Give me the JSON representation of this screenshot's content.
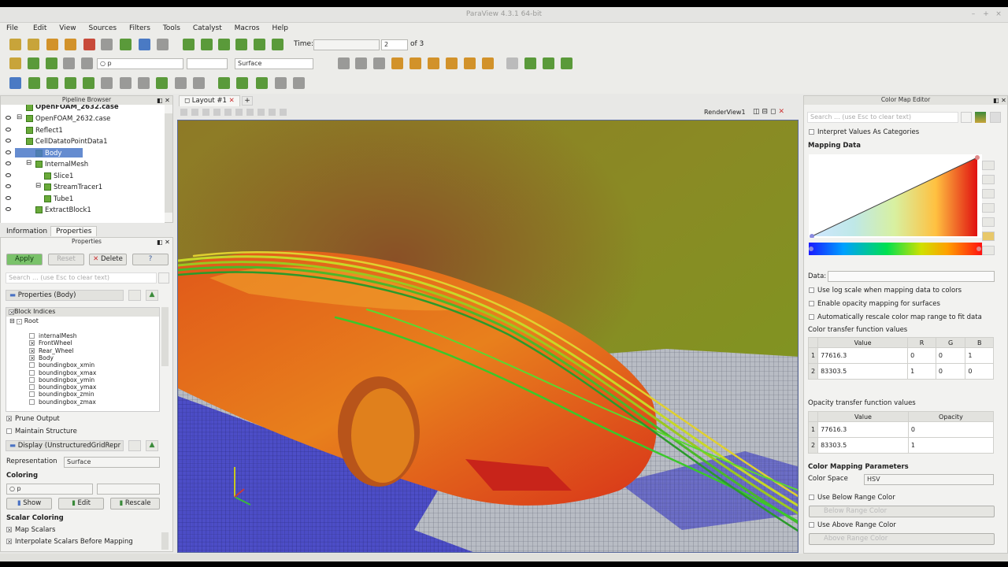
{
  "window": {
    "title": "ParaView 4.3.1 64-bit"
  },
  "menu": [
    "File",
    "Edit",
    "View",
    "Sources",
    "Filters",
    "Tools",
    "Catalyst",
    "Macros",
    "Help"
  ],
  "time": {
    "label": "Time:",
    "value": "",
    "index": "2",
    "of": "of 3"
  },
  "toolbar2": {
    "variable": "○ p",
    "representation": "Surface"
  },
  "pipeline": {
    "title": "Pipeline Browser",
    "items": [
      {
        "label": "OpenFOAM_2632.case",
        "depth": 1
      },
      {
        "label": "OpenFOAM_2632.case",
        "depth": 1
      },
      {
        "label": "Reflect1",
        "depth": 1
      },
      {
        "label": "CellDatatoPointData1",
        "depth": 1
      },
      {
        "label": "Body",
        "depth": 2,
        "selected": true
      },
      {
        "label": "InternalMesh",
        "depth": 2
      },
      {
        "label": "Slice1",
        "depth": 3
      },
      {
        "label": "StreamTracer1",
        "depth": 3
      },
      {
        "label": "Tube1",
        "depth": 3
      },
      {
        "label": "ExtractBlock1",
        "depth": 2
      }
    ]
  },
  "tabs": {
    "information": "Information",
    "properties": "Properties"
  },
  "properties": {
    "title": "Properties",
    "apply": "Apply",
    "reset": "Reset",
    "delete": "Delete",
    "help": "?",
    "search_placeholder": "Search ... (use Esc to clear text)",
    "section_body": "Properties (Body)",
    "block_indices": "Block Indices",
    "root": "Root",
    "blocks": [
      {
        "label": "internalMesh",
        "checked": false
      },
      {
        "label": "FrontWheel",
        "checked": true
      },
      {
        "label": "Rear_Wheel",
        "checked": true
      },
      {
        "label": "Body",
        "checked": true
      },
      {
        "label": "boundingbox_xmin",
        "checked": false
      },
      {
        "label": "boundingbox_xmax",
        "checked": false
      },
      {
        "label": "boundingbox_ymin",
        "checked": false
      },
      {
        "label": "boundingbox_ymax",
        "checked": false
      },
      {
        "label": "boundingbox_zmin",
        "checked": false
      },
      {
        "label": "boundingbox_zmax",
        "checked": false
      }
    ],
    "prune_output": "Prune Output",
    "maintain_structure": "Maintain Structure",
    "section_display": "Display (UnstructuredGridRepr",
    "representation_label": "Representation",
    "representation_value": "Surface",
    "coloring": "Coloring",
    "coloring_value": "○ p",
    "show": "Show",
    "edit": "Edit",
    "rescale": "Rescale",
    "scalar_coloring": "Scalar Coloring",
    "map_scalars": "Map Scalars",
    "interpolate": "Interpolate Scalars Before Mapping"
  },
  "layout": {
    "tab": "Layout #1",
    "view": "RenderView1"
  },
  "cme": {
    "title": "Color Map Editor",
    "search_placeholder": "Search ... (use Esc to clear text)",
    "interpret": "Interpret Values As Categories",
    "mapping_data": "Mapping Data",
    "data_label": "Data:",
    "log_scale": "Use log scale when mapping data to colors",
    "opacity_map": "Enable opacity mapping for surfaces",
    "auto_rescale": "Automatically rescale color map range to fit data",
    "ctf_title": "Color transfer function values",
    "ctf_headers": [
      "Value",
      "R",
      "G",
      "B"
    ],
    "ctf_rows": [
      [
        "1",
        "77616.3",
        "0",
        "0",
        "1"
      ],
      [
        "2",
        "83303.5",
        "1",
        "0",
        "0"
      ]
    ],
    "otf_title": "Opacity transfer function values",
    "otf_headers": [
      "Value",
      "Opacity"
    ],
    "otf_rows": [
      [
        "1",
        "77616.3",
        "0"
      ],
      [
        "2",
        "83303.5",
        "1"
      ]
    ],
    "params_title": "Color Mapping Parameters",
    "color_space_label": "Color Space",
    "color_space": "HSV",
    "below_range": "Use Below Range Color",
    "below_range_btn": "Below Range Color",
    "above_range": "Use Above Range Color",
    "above_range_btn": "Above Range Color"
  },
  "colors": {
    "accent": "#4a72c4",
    "apply": "#7ac26a",
    "selected": "#4a78c8"
  }
}
